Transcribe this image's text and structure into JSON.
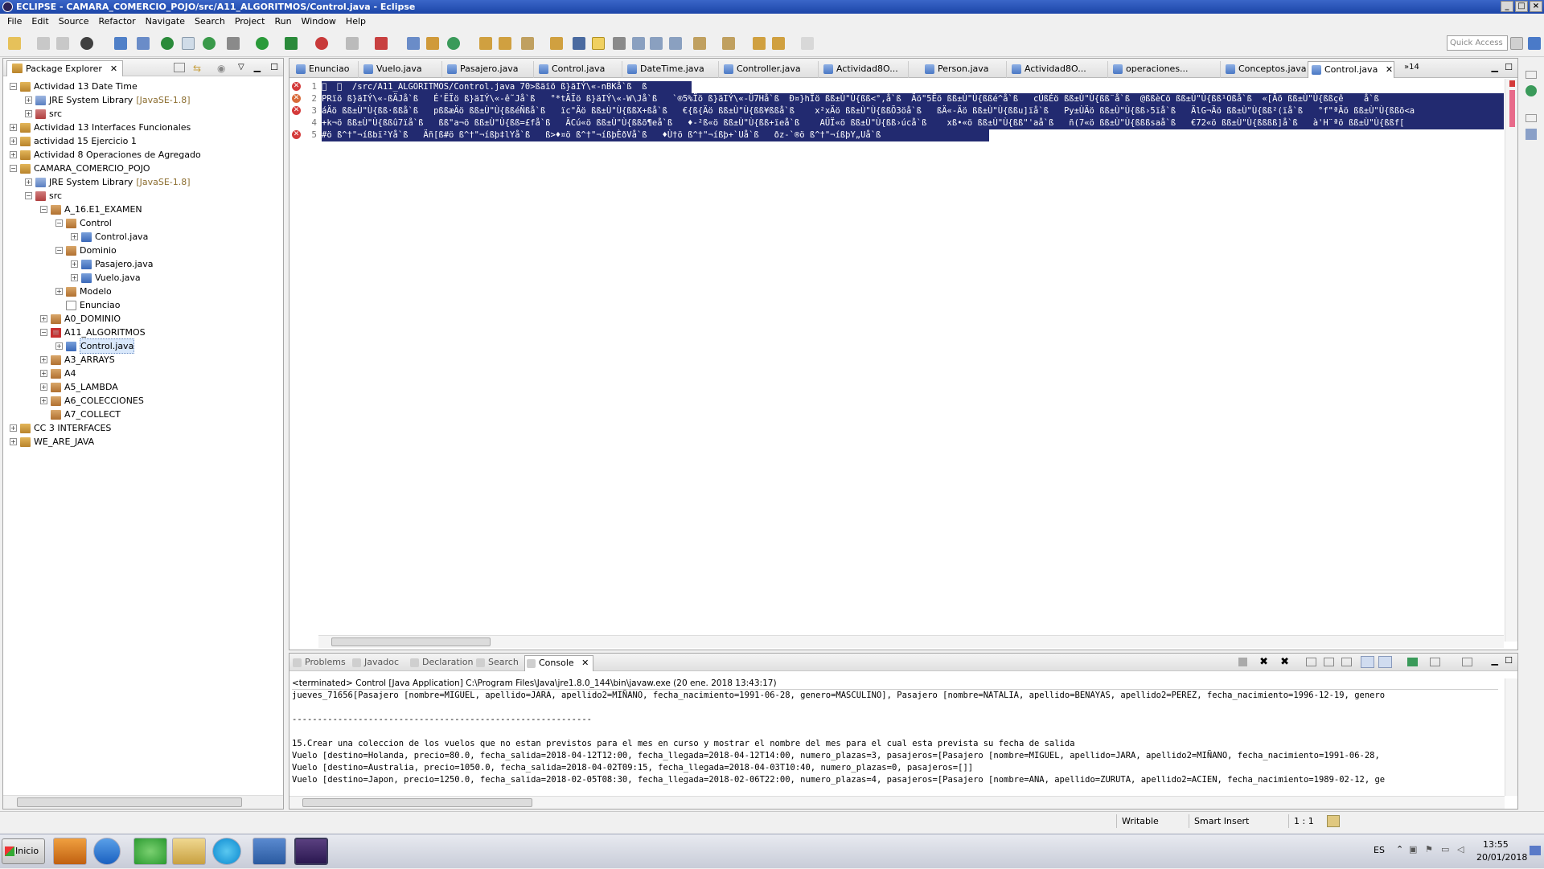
{
  "window": {
    "title": "ECLIPSE - CAMARA_COMERCIO_POJO/src/A11_ALGORITMOS/Control.java - Eclipse"
  },
  "menu": [
    "File",
    "Edit",
    "Source",
    "Refactor",
    "Navigate",
    "Search",
    "Project",
    "Run",
    "Window",
    "Help"
  ],
  "toolbar": {
    "quick_access_placeholder": "Quick Access"
  },
  "package_explorer": {
    "title": "Package Explorer",
    "tree": [
      {
        "label": "Actividad 13 Date Time",
        "depth": 0,
        "icon": "project-icon",
        "expander": "−"
      },
      {
        "label": "JRE System Library",
        "suffix": "[JavaSE-1.8]",
        "depth": 1,
        "icon": "library-icon",
        "expander": "+"
      },
      {
        "label": "src",
        "depth": 1,
        "icon": "source-folder-icon",
        "expander": "+"
      },
      {
        "label": "Actividad 13 Interfaces Funcionales",
        "depth": 0,
        "icon": "project-icon",
        "expander": "+"
      },
      {
        "label": "actividad 15 Ejercicio 1",
        "depth": 0,
        "icon": "project-icon",
        "expander": "+"
      },
      {
        "label": "Actividad 8 Operaciones de Agregado",
        "depth": 0,
        "icon": "project-icon",
        "expander": "+"
      },
      {
        "label": "CAMARA_COMERCIO_POJO",
        "depth": 0,
        "icon": "project-icon",
        "expander": "−"
      },
      {
        "label": "JRE System Library",
        "suffix": "[JavaSE-1.8]",
        "depth": 1,
        "icon": "library-icon",
        "expander": "+"
      },
      {
        "label": "src",
        "depth": 1,
        "icon": "source-folder-icon",
        "expander": "−"
      },
      {
        "label": "A_16.E1_EXAMEN",
        "depth": 2,
        "icon": "package-icon",
        "expander": "−"
      },
      {
        "label": "Control",
        "depth": 3,
        "icon": "package-icon",
        "expander": "−"
      },
      {
        "label": "Control.java",
        "depth": 4,
        "icon": "java-file-icon",
        "expander": "+"
      },
      {
        "label": "Dominio",
        "depth": 3,
        "icon": "package-icon",
        "expander": "−"
      },
      {
        "label": "Pasajero.java",
        "depth": 4,
        "icon": "java-file-icon",
        "expander": "+"
      },
      {
        "label": "Vuelo.java",
        "depth": 4,
        "icon": "java-file-icon",
        "expander": "+"
      },
      {
        "label": "Modelo",
        "depth": 3,
        "icon": "package-icon",
        "expander": "+"
      },
      {
        "label": "Enunciao",
        "depth": 3,
        "icon": "text-file-icon",
        "expander": ""
      },
      {
        "label": "A0_DOMINIO",
        "depth": 2,
        "icon": "package-icon",
        "expander": "+"
      },
      {
        "label": "A11_ALGORITMOS",
        "depth": 2,
        "icon": "package-error-icon",
        "expander": "−"
      },
      {
        "label": "Control.java",
        "depth": 3,
        "icon": "java-error-icon",
        "expander": "+",
        "selected": true
      },
      {
        "label": "A3_ARRAYS",
        "depth": 2,
        "icon": "package-icon",
        "expander": "+"
      },
      {
        "label": "A4",
        "depth": 2,
        "icon": "package-icon",
        "expander": "+"
      },
      {
        "label": "A5_LAMBDA",
        "depth": 2,
        "icon": "package-icon",
        "expander": "+"
      },
      {
        "label": "A6_COLECCIONES",
        "depth": 2,
        "icon": "package-icon",
        "expander": "+"
      },
      {
        "label": "A7_COLLECT",
        "depth": 2,
        "icon": "package-icon",
        "expander": ""
      },
      {
        "label": "CC 3 INTERFACES",
        "depth": 0,
        "icon": "project-icon",
        "expander": "+"
      },
      {
        "label": "WE_ARE_JAVA",
        "depth": 0,
        "icon": "project-icon",
        "expander": "+"
      }
    ]
  },
  "editor": {
    "tabs": [
      "Enunciao",
      "Vuelo.java",
      "Pasajero.java",
      "Control.java",
      "DateTime.java",
      "Controller.java",
      "Actividad8O...",
      "Person.java",
      "Actividad8O...",
      "operaciones...",
      "Conceptos.java",
      "Control.java"
    ],
    "active_tab": 11,
    "overflow_count": "»14",
    "lines": [
      {
        "number": "1",
        "text": "\u0000  \u0000  /src/A11_ALGORITMOS/Control.java 70>ßäïö ß}äIÝ\\«-nBKå`ß  ß"
      },
      {
        "number": "2",
        "text": "PRïö ß}äIÝ\\«-ßÄJå`ß   É'ËÏö ß}äIÝ\\«-ê˜Jå`ß   °*tÄÏö ß}äIÝ\\«-W\\Jå`ß   `®5%Ïö ß}äIÝ\\«-Ü7Hå`ß  Ð¤}hÏö ßß±Ù\"Ù{ßß<°,å`ß  Äö\"5Ëö ßß±Ù\"Ù{ßßé^å`ß   cÚßÉö ßß±Ù\"Ù{ßß¨å`ß  @ßßèCö ßß±Ù\"Ù{ßß¹Oßå`ß  «[Äö ßß±Ù\"Ù{ßßçê    å`ß"
      },
      {
        "number": "3",
        "text": "áÄö ßß±Ù\"Ù{ßß·ßßå`ß   pßßæÄö ßß±Ù\"Ù{ßßéÑßå`ß   ïc\"Äö ßß±Ù\"Ù{ßßX+ßå`ß   €{ß{Äö ßß±Ù\"Ù{ßß¥ßßå`ß    x²xÄö ßß±Ù\"Ù{ßßÕ3öå`ß   ßÄ«-Äö ßß±Ù\"Ù{ßßu]ïå`ß   Py±ÙÄö ßß±Ù\"Ù{ßß›5ïå`ß   ÄlG¬Äö ßß±Ù\"Ù{ßß²(ïå`ß   °f\"ªÄö ßß±Ù\"Ù{ßßõ<a"
      },
      {
        "number": "4",
        "text": "+k¬ö ßß±Ù\"Ù{ßßû7ïå`ß   ßß\"a¬ö ßß±Ù\"Ù{ßß=£få`ß   ÄCú«ö ßß±Ù\"Ù{ßßõ¶eå`ß   ♦-²ß«ö ßß±Ù\"Ù{ßß+ïeå`ß    AÜÏ«ö ßß±Ù\"Ù{ßß›úcå`ß    xß•«ö ßß±Ù\"Ù{ßß\"'aå`ß   ñ(7«ö ßß±Ù\"Ù{ßßßsaå`ß   €72«ö ßß±Ù\"Ù{ßßßß]å`ß   à'H¨ªö ßß±Ù\"Ù{ßßf["
      },
      {
        "number": "5",
        "text": "#ö ß^†\"¬íßbï²Yå`ß   Äñ[ß#ö ß^†\"¬íßþ‡lYå`ß   ß>♦¤ö ß^†\"¬íßþÈðVå`ß   ♦Ù†ö ß^†\"¬íßþ+`Uå`ß   ðz-`®ö ß^†\"¬íßþY„Uå`ß"
      }
    ]
  },
  "console": {
    "tabs": [
      "Problems",
      "Javadoc",
      "Declaration",
      "Search",
      "Console"
    ],
    "active_tab": 4,
    "terminated": "<terminated> Control [Java Application] C:\\Program Files\\Java\\jre1.8.0_144\\bin\\javaw.exe (20 ene. 2018 13:43:17)",
    "lines": [
      "jueves_71656[Pasajero [nombre=MIGUEL, apellido=JARA, apellido2=MIÑANO, fecha_nacimiento=1991-06-28, genero=MASCULINO], Pasajero [nombre=NATALIA, apellido=BENAYAS, apellido2=PEREZ, fecha_nacimiento=1996-12-19, genero",
      "-----------------------------------------------------------",
      "",
      "15.Crear una coleccion de los vuelos que no estan previstos para el mes en curso y mostrar el nombre del mes para el cual esta prevista su fecha de salida",
      "Vuelo [destino=Holanda, precio=80.0, fecha_salida=2018-04-12T12:00, fecha_llegada=2018-04-12T14:00, numero_plazas=3, pasajeros=[Pasajero [nombre=MIGUEL, apellido=JARA, apellido2=MIÑANO, fecha_nacimiento=1991-06-28,",
      "Vuelo [destino=Australia, precio=1050.0, fecha_salida=2018-04-02T09:15, fecha_llegada=2018-04-03T10:40, numero_plazas=0, pasajeros=[]]",
      "Vuelo [destino=Japon, precio=1250.0, fecha_salida=2018-02-05T08:30, fecha_llegada=2018-02-06T22:00, numero_plazas=4, pasajeros=[Pasajero [nombre=ANA, apellido=ZURUTA, apellido2=ACIEN, fecha_nacimiento=1989-02-12, ge"
    ]
  },
  "status": {
    "writable": "Writable",
    "insert_mode": "Smart Insert",
    "position": "1 : 1"
  },
  "taskbar": {
    "start_label": "Inicio",
    "language": "ES",
    "time": "13:55",
    "date": "20/01/2018"
  }
}
